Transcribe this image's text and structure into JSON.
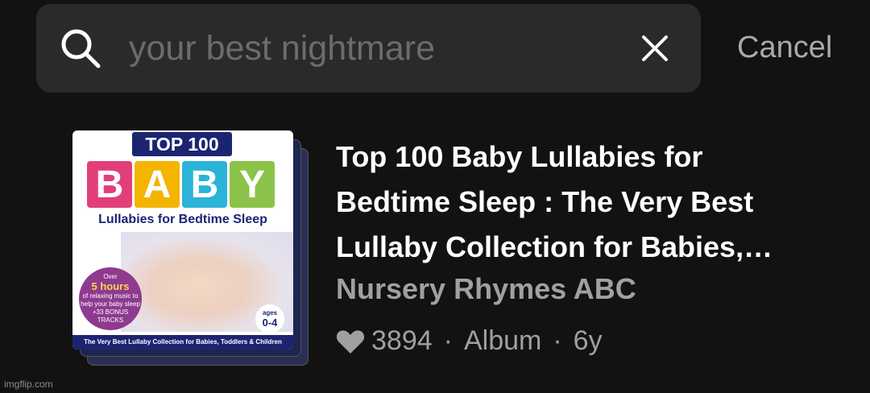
{
  "search": {
    "placeholder": "your best nightmare",
    "icon": "search-icon",
    "clear_icon": "close-icon",
    "cancel_label": "Cancel"
  },
  "result": {
    "title": "Top 100 Baby Lullabies for Bedtime Sleep : The Very Best Lullaby Collection for Babies,…",
    "artist": "Nursery Rhymes ABC",
    "likes": "3894",
    "type": "Album",
    "age": "6y",
    "separator": "·",
    "like_icon": "heart-icon",
    "cover": {
      "top_label": "TOP 100",
      "letters": [
        "B",
        "A",
        "B",
        "Y"
      ],
      "letter_colors": [
        "#e23f7a",
        "#f4b400",
        "#2bb3d8",
        "#8bc34a"
      ],
      "subtitle": "Lullabies for Bedtime Sleep",
      "badge_line1": "Over",
      "badge_line2": "5 hours",
      "badge_line3": "of relaxing music to help your baby sleep",
      "badge_line4": "+33 BONUS TRACKS",
      "ages_label": "ages",
      "ages_value": "0-4",
      "bottom_text": "The Very Best Lullaby Collection for Babies, Toddlers & Children"
    }
  },
  "watermark": "imgflip.com",
  "colors": {
    "background": "#121212",
    "search_bar": "#2a2a2a",
    "title_text": "#ffffff",
    "secondary_text": "#a0a0a0"
  }
}
